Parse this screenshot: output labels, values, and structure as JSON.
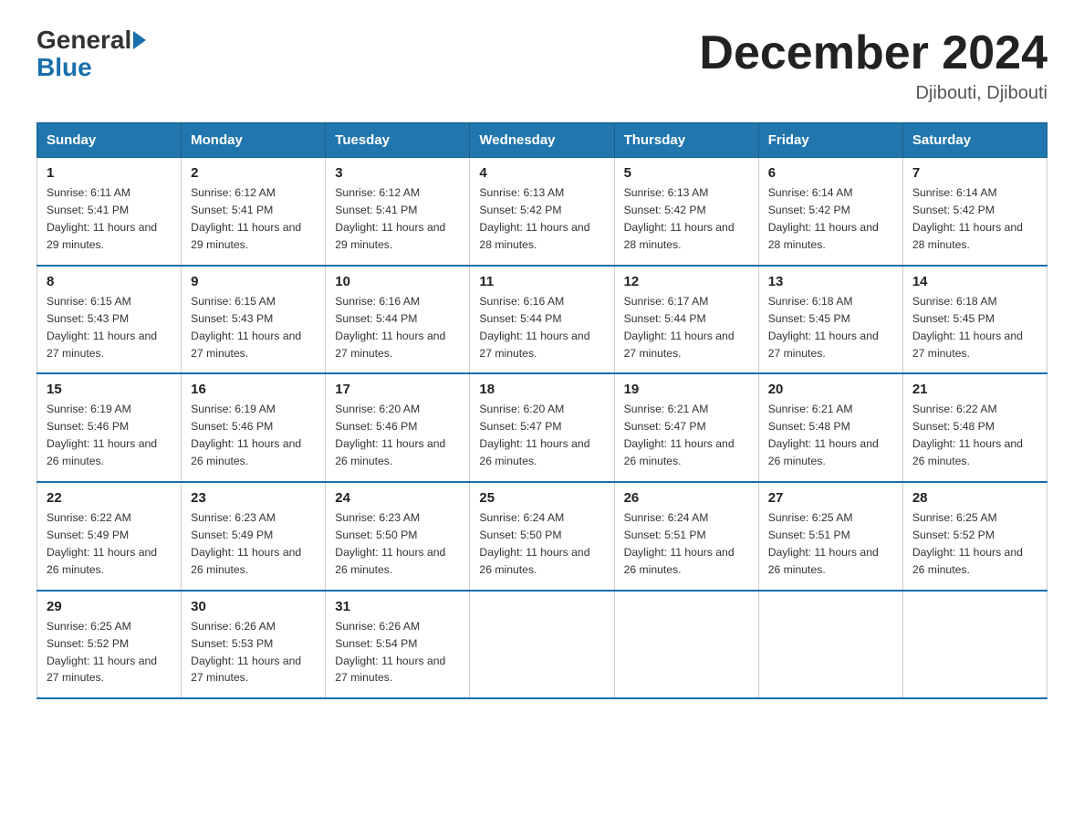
{
  "logo": {
    "general": "General",
    "blue": "Blue"
  },
  "header": {
    "title": "December 2024",
    "location": "Djibouti, Djibouti"
  },
  "days_of_week": [
    "Sunday",
    "Monday",
    "Tuesday",
    "Wednesday",
    "Thursday",
    "Friday",
    "Saturday"
  ],
  "weeks": [
    [
      {
        "day": "1",
        "sunrise": "6:11 AM",
        "sunset": "5:41 PM",
        "daylight": "11 hours and 29 minutes."
      },
      {
        "day": "2",
        "sunrise": "6:12 AM",
        "sunset": "5:41 PM",
        "daylight": "11 hours and 29 minutes."
      },
      {
        "day": "3",
        "sunrise": "6:12 AM",
        "sunset": "5:41 PM",
        "daylight": "11 hours and 29 minutes."
      },
      {
        "day": "4",
        "sunrise": "6:13 AM",
        "sunset": "5:42 PM",
        "daylight": "11 hours and 28 minutes."
      },
      {
        "day": "5",
        "sunrise": "6:13 AM",
        "sunset": "5:42 PM",
        "daylight": "11 hours and 28 minutes."
      },
      {
        "day": "6",
        "sunrise": "6:14 AM",
        "sunset": "5:42 PM",
        "daylight": "11 hours and 28 minutes."
      },
      {
        "day": "7",
        "sunrise": "6:14 AM",
        "sunset": "5:42 PM",
        "daylight": "11 hours and 28 minutes."
      }
    ],
    [
      {
        "day": "8",
        "sunrise": "6:15 AM",
        "sunset": "5:43 PM",
        "daylight": "11 hours and 27 minutes."
      },
      {
        "day": "9",
        "sunrise": "6:15 AM",
        "sunset": "5:43 PM",
        "daylight": "11 hours and 27 minutes."
      },
      {
        "day": "10",
        "sunrise": "6:16 AM",
        "sunset": "5:44 PM",
        "daylight": "11 hours and 27 minutes."
      },
      {
        "day": "11",
        "sunrise": "6:16 AM",
        "sunset": "5:44 PM",
        "daylight": "11 hours and 27 minutes."
      },
      {
        "day": "12",
        "sunrise": "6:17 AM",
        "sunset": "5:44 PM",
        "daylight": "11 hours and 27 minutes."
      },
      {
        "day": "13",
        "sunrise": "6:18 AM",
        "sunset": "5:45 PM",
        "daylight": "11 hours and 27 minutes."
      },
      {
        "day": "14",
        "sunrise": "6:18 AM",
        "sunset": "5:45 PM",
        "daylight": "11 hours and 27 minutes."
      }
    ],
    [
      {
        "day": "15",
        "sunrise": "6:19 AM",
        "sunset": "5:46 PM",
        "daylight": "11 hours and 26 minutes."
      },
      {
        "day": "16",
        "sunrise": "6:19 AM",
        "sunset": "5:46 PM",
        "daylight": "11 hours and 26 minutes."
      },
      {
        "day": "17",
        "sunrise": "6:20 AM",
        "sunset": "5:46 PM",
        "daylight": "11 hours and 26 minutes."
      },
      {
        "day": "18",
        "sunrise": "6:20 AM",
        "sunset": "5:47 PM",
        "daylight": "11 hours and 26 minutes."
      },
      {
        "day": "19",
        "sunrise": "6:21 AM",
        "sunset": "5:47 PM",
        "daylight": "11 hours and 26 minutes."
      },
      {
        "day": "20",
        "sunrise": "6:21 AM",
        "sunset": "5:48 PM",
        "daylight": "11 hours and 26 minutes."
      },
      {
        "day": "21",
        "sunrise": "6:22 AM",
        "sunset": "5:48 PM",
        "daylight": "11 hours and 26 minutes."
      }
    ],
    [
      {
        "day": "22",
        "sunrise": "6:22 AM",
        "sunset": "5:49 PM",
        "daylight": "11 hours and 26 minutes."
      },
      {
        "day": "23",
        "sunrise": "6:23 AM",
        "sunset": "5:49 PM",
        "daylight": "11 hours and 26 minutes."
      },
      {
        "day": "24",
        "sunrise": "6:23 AM",
        "sunset": "5:50 PM",
        "daylight": "11 hours and 26 minutes."
      },
      {
        "day": "25",
        "sunrise": "6:24 AM",
        "sunset": "5:50 PM",
        "daylight": "11 hours and 26 minutes."
      },
      {
        "day": "26",
        "sunrise": "6:24 AM",
        "sunset": "5:51 PM",
        "daylight": "11 hours and 26 minutes."
      },
      {
        "day": "27",
        "sunrise": "6:25 AM",
        "sunset": "5:51 PM",
        "daylight": "11 hours and 26 minutes."
      },
      {
        "day": "28",
        "sunrise": "6:25 AM",
        "sunset": "5:52 PM",
        "daylight": "11 hours and 26 minutes."
      }
    ],
    [
      {
        "day": "29",
        "sunrise": "6:25 AM",
        "sunset": "5:52 PM",
        "daylight": "11 hours and 27 minutes."
      },
      {
        "day": "30",
        "sunrise": "6:26 AM",
        "sunset": "5:53 PM",
        "daylight": "11 hours and 27 minutes."
      },
      {
        "day": "31",
        "sunrise": "6:26 AM",
        "sunset": "5:54 PM",
        "daylight": "11 hours and 27 minutes."
      },
      null,
      null,
      null,
      null
    ]
  ]
}
